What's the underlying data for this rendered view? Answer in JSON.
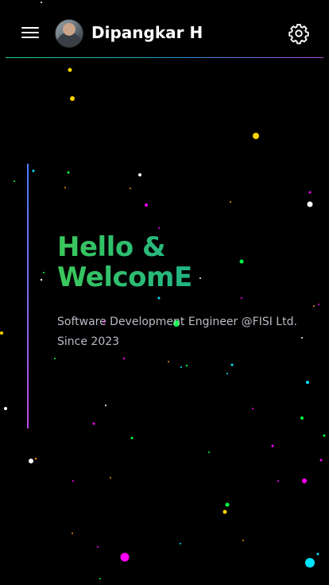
{
  "header": {
    "menu_icon": "hamburger-menu-icon",
    "avatar_alt": "Dipangkar H profile photo",
    "name": "Dipangkar H",
    "settings_icon": "gear-icon"
  },
  "hero": {
    "title_line1": "Hello &",
    "title_line2": "WelcomE",
    "subtitle_line1": "Software Development Engineer @FISI Ltd.",
    "subtitle_line2": "Since 2023"
  },
  "colors": {
    "background": "#000000",
    "text_primary": "#ffffff",
    "title_gradient": [
      "#3bc85a",
      "#1aa5a9"
    ],
    "subtitle": "#b9bcc4",
    "accent_line": [
      "#4c7bff",
      "#c048e0"
    ],
    "particles": [
      "#ffd400",
      "#00e5ff",
      "#00ff44",
      "#ff00ff",
      "#ffffff",
      "#ff8c00"
    ]
  }
}
